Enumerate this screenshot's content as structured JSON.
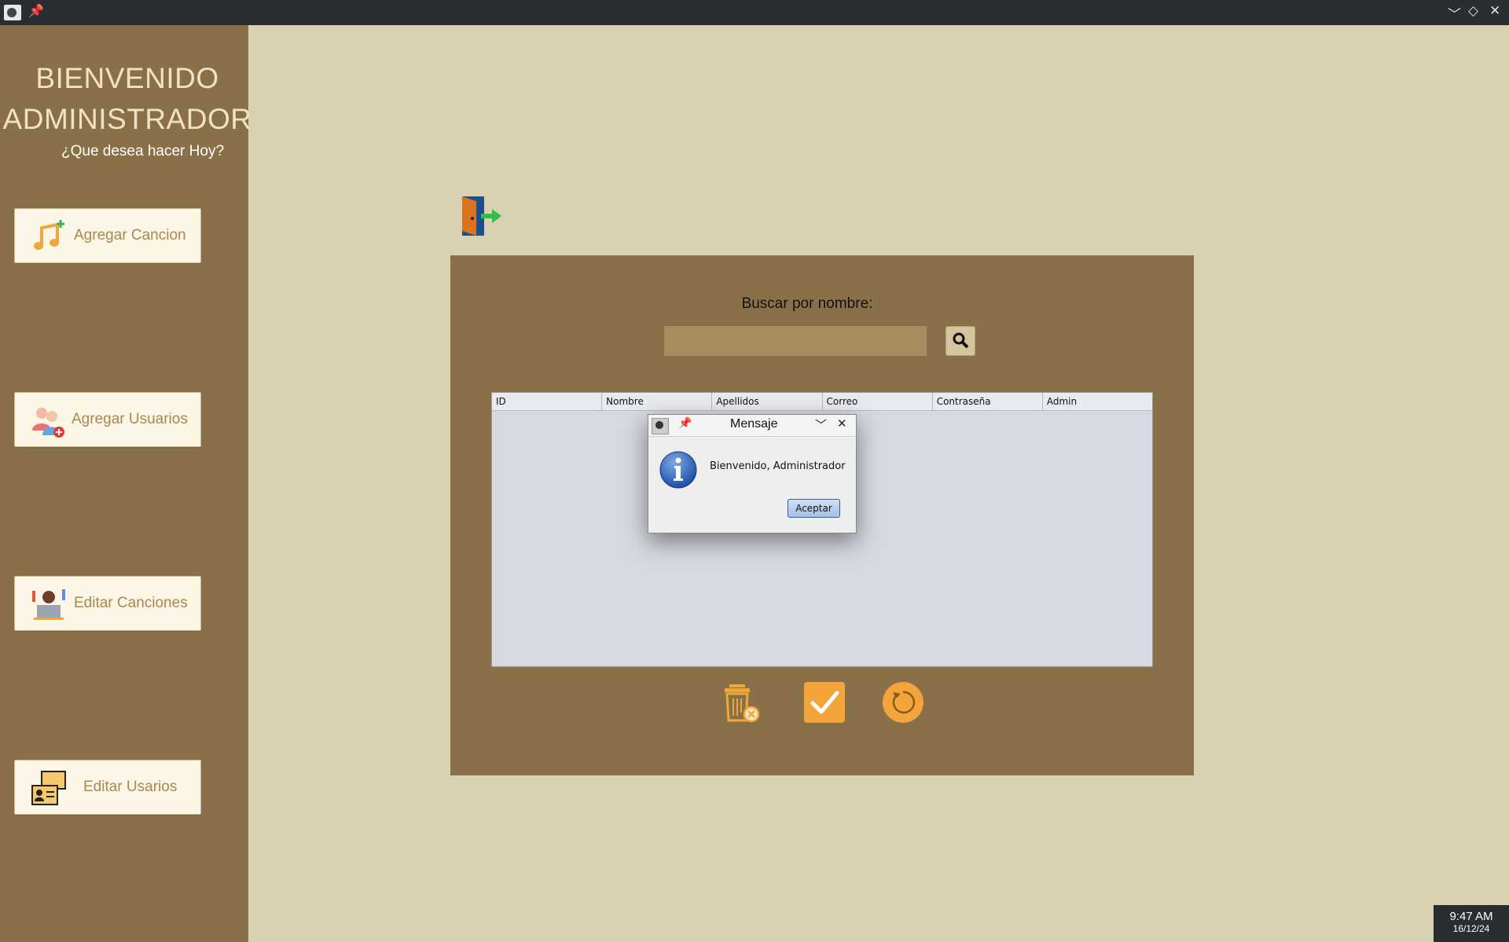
{
  "window": {
    "controls": {
      "minimize": "﹀",
      "maximize": "◇",
      "close": "✕"
    }
  },
  "sidebar": {
    "title_line1": "BIENVENIDO",
    "title_line2": "ADMINISTRADOR",
    "subtitle": "¿Que desea hacer Hoy?",
    "buttons": [
      {
        "label": "Agregar Cancion",
        "icon": "music-add-icon"
      },
      {
        "label": "Agregar Usuarios",
        "icon": "add-users-icon"
      },
      {
        "label": "Editar Canciones",
        "icon": "edit-songs-icon"
      },
      {
        "label": "Editar Usarios",
        "icon": "edit-users-icon"
      }
    ]
  },
  "main": {
    "exit_icon": "logout-door-icon",
    "search": {
      "label": "Buscar por nombre:",
      "value": "",
      "placeholder": ""
    },
    "table": {
      "columns": [
        "ID",
        "Nombre",
        "Apellidos",
        "Correo",
        "Contraseña",
        "Admin"
      ],
      "rows": []
    },
    "actions": [
      {
        "icon": "delete-trash-icon"
      },
      {
        "icon": "confirm-check-icon"
      },
      {
        "icon": "refresh-icon"
      }
    ]
  },
  "dialog": {
    "title": "Mensaje",
    "message": "Bienvenido, Administrador",
    "ok_label": "Aceptar",
    "icon": "info-icon"
  },
  "taskbar": {
    "time": "9:47 AM",
    "date": "16/12/24"
  },
  "colors": {
    "background": "#d8d2b3",
    "sidebar": "#8a7048",
    "panel": "#8a7048",
    "button_text": "#a8884f",
    "accent_orange": "#f3a53b"
  }
}
